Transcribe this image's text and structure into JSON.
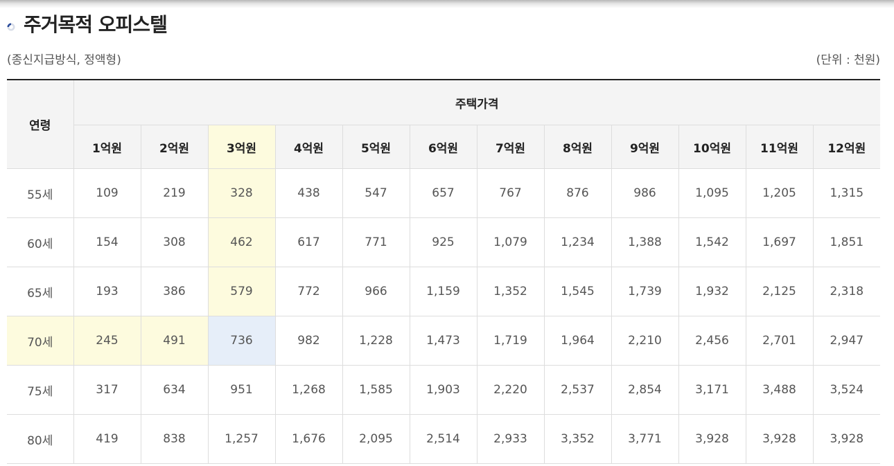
{
  "title": "주거목적 오피스텔",
  "subtitle": "(종신지급방식, 정액형)",
  "unit": "(단위 : 천원)",
  "icons": {
    "bullet": "spinner-bullet-icon"
  },
  "colors": {
    "highlight_yellow": "#fdfbde",
    "highlight_blue": "#e6eef9",
    "header_bg": "#f4f4f4"
  },
  "table": {
    "age_header": "연령",
    "price_header": "주택가격",
    "columns": [
      "1억원",
      "2억원",
      "3억원",
      "4억원",
      "5억원",
      "6억원",
      "7억원",
      "8억원",
      "9억원",
      "10억원",
      "11억원",
      "12억원"
    ],
    "rows": [
      {
        "age": "55세",
        "values": [
          "109",
          "219",
          "328",
          "438",
          "547",
          "657",
          "767",
          "876",
          "986",
          "1,095",
          "1,205",
          "1,315"
        ]
      },
      {
        "age": "60세",
        "values": [
          "154",
          "308",
          "462",
          "617",
          "771",
          "925",
          "1,079",
          "1,234",
          "1,388",
          "1,542",
          "1,697",
          "1,851"
        ]
      },
      {
        "age": "65세",
        "values": [
          "193",
          "386",
          "579",
          "772",
          "966",
          "1,159",
          "1,352",
          "1,545",
          "1,739",
          "1,932",
          "2,125",
          "2,318"
        ]
      },
      {
        "age": "70세",
        "values": [
          "245",
          "491",
          "736",
          "982",
          "1,228",
          "1,473",
          "1,719",
          "1,964",
          "2,210",
          "2,456",
          "2,701",
          "2,947"
        ]
      },
      {
        "age": "75세",
        "values": [
          "317",
          "634",
          "951",
          "1,268",
          "1,585",
          "1,903",
          "2,220",
          "2,537",
          "2,854",
          "3,171",
          "3,488",
          "3,524"
        ]
      },
      {
        "age": "80세",
        "values": [
          "419",
          "838",
          "1,257",
          "1,676",
          "2,095",
          "2,514",
          "2,933",
          "3,352",
          "3,771",
          "3,928",
          "3,928",
          "3,928"
        ]
      }
    ],
    "highlight": {
      "column_index": 2,
      "row_index": 3,
      "intersection_color": "blue",
      "line_color": "yellow"
    }
  }
}
